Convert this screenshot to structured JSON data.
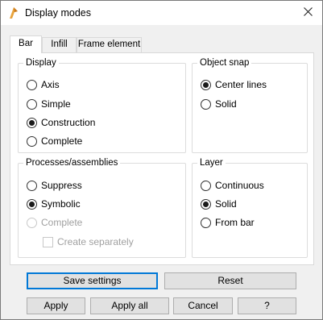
{
  "window": {
    "title": "Display modes"
  },
  "tabs": [
    {
      "label": "Bar",
      "active": true
    },
    {
      "label": "Infill",
      "active": false
    },
    {
      "label": "Frame element",
      "active": false
    }
  ],
  "groups": {
    "display": {
      "label": "Display",
      "options": [
        {
          "label": "Axis",
          "checked": false,
          "disabled": false
        },
        {
          "label": "Simple",
          "checked": false,
          "disabled": false
        },
        {
          "label": "Construction",
          "checked": true,
          "disabled": false
        },
        {
          "label": "Complete",
          "checked": false,
          "disabled": false
        }
      ]
    },
    "object_snap": {
      "label": "Object snap",
      "options": [
        {
          "label": "Center lines",
          "checked": true,
          "disabled": false
        },
        {
          "label": "Solid",
          "checked": false,
          "disabled": false
        }
      ]
    },
    "processes": {
      "label": "Processes/assemblies",
      "options": [
        {
          "label": "Suppress",
          "checked": false,
          "disabled": false
        },
        {
          "label": "Symbolic",
          "checked": true,
          "disabled": false
        },
        {
          "label": "Complete",
          "checked": false,
          "disabled": true
        }
      ],
      "checkbox": {
        "label": "Create separately",
        "checked": false,
        "disabled": true
      }
    },
    "layer": {
      "label": "Layer",
      "options": [
        {
          "label": "Continuous",
          "checked": false,
          "disabled": false
        },
        {
          "label": "Solid",
          "checked": true,
          "disabled": false
        },
        {
          "label": "From bar",
          "checked": false,
          "disabled": false
        }
      ]
    }
  },
  "buttons": {
    "save_settings": "Save settings",
    "reset": "Reset",
    "apply": "Apply",
    "apply_all": "Apply all",
    "cancel": "Cancel",
    "help": "?"
  },
  "colors": {
    "accent": "#0078d7",
    "app_icon": "#e8a33d",
    "disabled_text": "#a0a0a0"
  },
  "icons": {
    "app": "app-logo-icon",
    "close": "close-icon"
  }
}
